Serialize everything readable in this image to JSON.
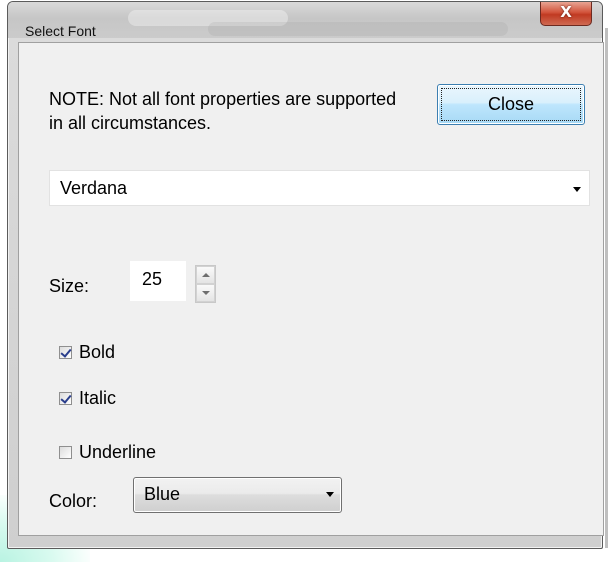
{
  "window": {
    "title": "Select Font",
    "close_glyph": "X"
  },
  "note": "NOTE: Not all font properties are supported in all circumstances.",
  "buttons": {
    "close_label": "Close"
  },
  "font": {
    "selected": "Verdana"
  },
  "size": {
    "label": "Size:",
    "value": "25"
  },
  "styles": {
    "bold": {
      "label": "Bold",
      "checked": true
    },
    "italic": {
      "label": "Italic",
      "checked": true
    },
    "underline": {
      "label": "Underline",
      "checked": false
    }
  },
  "color": {
    "label": "Color:",
    "selected": "Blue"
  },
  "icons": {
    "close": "close-icon",
    "dropdown": "chevron-down-icon",
    "spin_up": "spin-up-icon",
    "spin_down": "spin-down-icon",
    "check": "checkmark-icon"
  },
  "colors": {
    "close_button_red": "#c9452e",
    "default_button_blue": "#bee6fd",
    "checkmark": "#2a3e8c"
  }
}
